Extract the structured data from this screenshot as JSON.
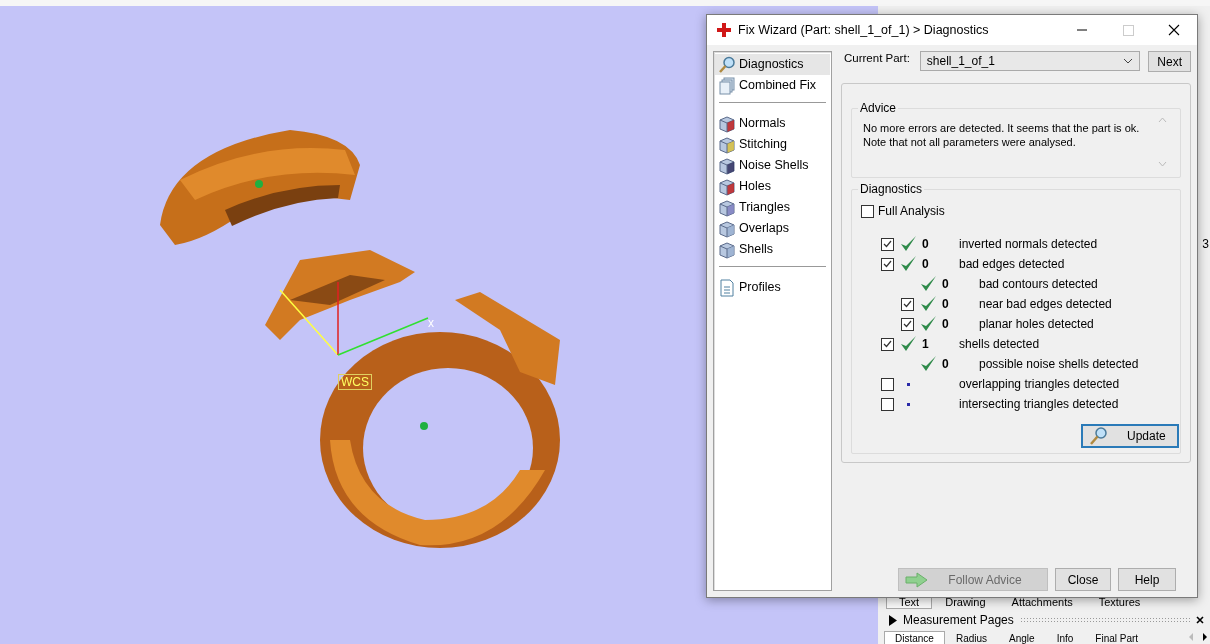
{
  "viewport": {
    "axis_label": "x",
    "origin_label": "WCS"
  },
  "side_panel": {
    "marker": "3",
    "tabs": [
      {
        "label": "Text",
        "selected": true
      },
      {
        "label": "Drawing",
        "selected": false
      },
      {
        "label": "Attachments",
        "selected": false
      },
      {
        "label": "Textures",
        "selected": false
      }
    ],
    "section": {
      "title": "Measurement Pages",
      "expanded": false
    },
    "section_tabs": [
      {
        "label": "Distance",
        "selected": true
      },
      {
        "label": "Radius",
        "selected": false
      },
      {
        "label": "Angle",
        "selected": false
      },
      {
        "label": "Info",
        "selected": false
      },
      {
        "label": "Final Part",
        "selected": false
      }
    ]
  },
  "dialog": {
    "title": "Fix Wizard (Part: shell_1_of_1) > Diagnostics",
    "nav_groups": [
      [
        {
          "label": "Diagnostics",
          "selected": true
        },
        {
          "label": "Combined Fix",
          "selected": false
        }
      ],
      [
        {
          "label": "Normals",
          "selected": false
        },
        {
          "label": "Stitching",
          "selected": false
        },
        {
          "label": "Noise Shells",
          "selected": false
        },
        {
          "label": "Holes",
          "selected": false
        },
        {
          "label": "Triangles",
          "selected": false
        },
        {
          "label": "Overlaps",
          "selected": false
        },
        {
          "label": "Shells",
          "selected": false
        }
      ],
      [
        {
          "label": "Profiles",
          "selected": false
        }
      ]
    ],
    "current_part_label": "Current Part:",
    "current_part": "shell_1_of_1",
    "next_button": "Next",
    "advice": {
      "title": "Advice",
      "text": "No more errors are detected. It seems that the part is ok.\nNote that not all parameters were analysed."
    },
    "diagnostics": {
      "title": "Diagnostics",
      "full_analysis": {
        "label": "Full Analysis",
        "checked": false
      },
      "rows": [
        {
          "checked": true,
          "kind": "ok",
          "count": "0",
          "label": "inverted normals detected"
        },
        {
          "checked": true,
          "kind": "ok",
          "count": "0",
          "label": "bad edges detected",
          "children": [
            {
              "kind": "ok",
              "count": "0",
              "label": "bad contours detected"
            },
            {
              "checked": true,
              "kind": "ok",
              "count": "0",
              "label": "near bad edges detected"
            },
            {
              "checked": true,
              "kind": "ok",
              "count": "0",
              "label": "planar holes detected"
            }
          ]
        },
        {
          "checked": true,
          "kind": "ok",
          "count": "1",
          "label": "shells detected",
          "children": [
            {
              "kind": "ok",
              "count": "0",
              "label": "possible noise shells detected"
            }
          ]
        },
        {
          "checked": false,
          "kind": "pending",
          "label": "overlapping triangles detected"
        },
        {
          "checked": false,
          "kind": "pending",
          "label": "intersecting triangles detected"
        }
      ],
      "update_button": "Update"
    },
    "buttons": [
      {
        "label": "Follow Advice",
        "disabled": true
      },
      {
        "label": "Close",
        "disabled": false
      },
      {
        "label": "Help",
        "disabled": false
      }
    ]
  }
}
